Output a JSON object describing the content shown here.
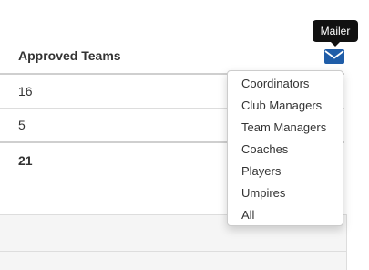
{
  "table": {
    "header": "Approved Teams",
    "rows": [
      "16",
      "5"
    ],
    "total": "21"
  },
  "mailer": {
    "icon": "envelope-icon",
    "icon_color": "#1f5da8",
    "tooltip": "Mailer"
  },
  "dropdown": {
    "items": [
      "Coordinators",
      "Club Managers",
      "Team Managers",
      "Coaches",
      "Players",
      "Umpires",
      "All"
    ]
  }
}
